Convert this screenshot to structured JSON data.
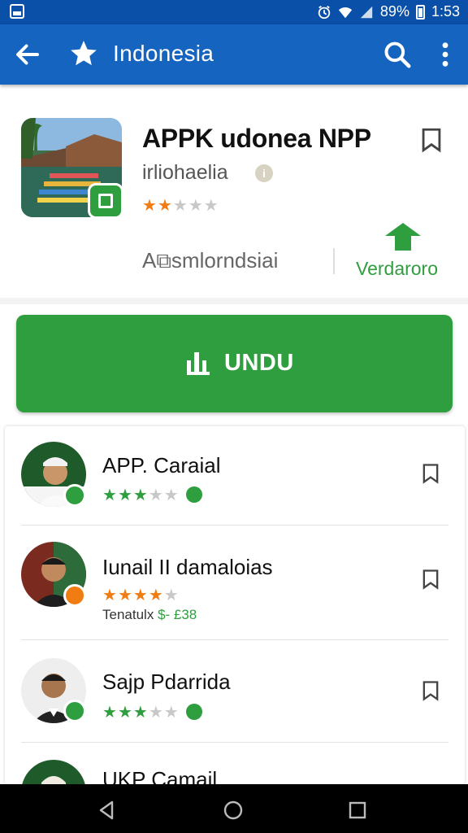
{
  "status_bar": {
    "battery": "89%",
    "time": "1:53"
  },
  "app_bar": {
    "title": "Indonesia"
  },
  "app": {
    "name": "APPK udonea NPP",
    "developer": "irliohaelia",
    "rating": 2,
    "rating_max": 5,
    "rating_label": "A⧉smlorndsiai",
    "update_label": "Verdaroro",
    "install_label": "UNDU"
  },
  "list": {
    "items": [
      {
        "name": "APP. Caraial",
        "rating": 3,
        "rating_max": 5,
        "badge_color": "#2e9e3e",
        "sub": ""
      },
      {
        "name": "Iunail II damaloias",
        "rating": 4,
        "rating_max": 5,
        "badge_color": "#f07c12",
        "sub_prefix": "Tenatulx",
        "sub_value": "$- £38"
      },
      {
        "name": "Sajp Pdarrida",
        "rating": 3,
        "rating_max": 5,
        "badge_color": "#2e9e3e",
        "sub": ""
      },
      {
        "name": "UKP Camail",
        "rating": 0,
        "rating_max": 5,
        "badge_color": "#2e9e3e",
        "sub": ""
      }
    ]
  },
  "colors": {
    "status_bar": "#0a4fa8",
    "app_bar": "#1565c0",
    "accent_green": "#2e9e3e",
    "star_orange": "#f07c12"
  },
  "icons": {
    "back": "arrow-left-icon",
    "favorite": "star-icon",
    "search": "search-icon",
    "more": "more-vert-icon",
    "bookmark": "bookmark-icon",
    "install": "download-bars-icon",
    "update": "up-arrow-icon"
  }
}
